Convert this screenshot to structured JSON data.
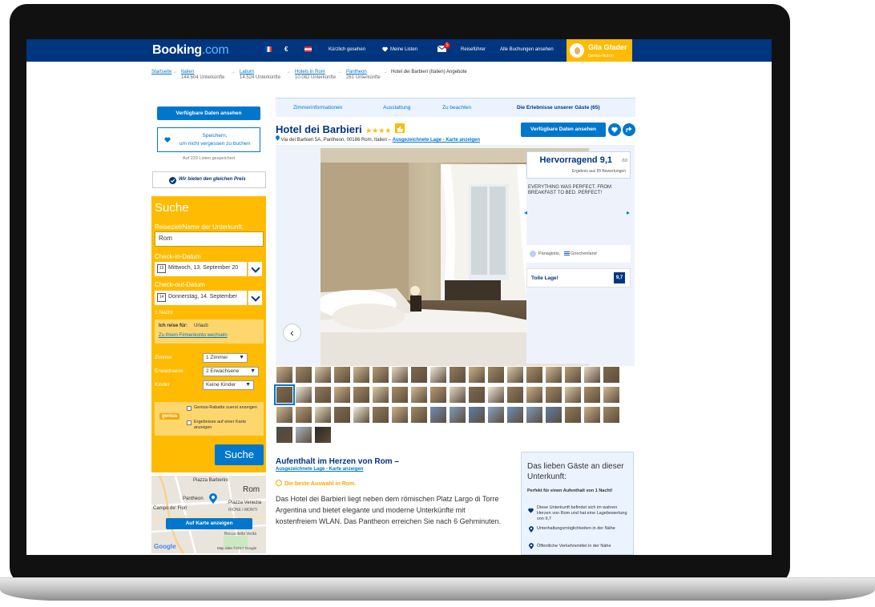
{
  "header": {
    "logo_main": "Booking",
    "logo_dot": ".com",
    "currency": "€",
    "recently_viewed": "Kürzlich gesehen",
    "my_lists": "Meine Listen",
    "mail_badge": "5",
    "travel_guide": "Reiseführer",
    "all_bookings": "Alle Buchungen ansehen",
    "user_name": "Gila Gfader",
    "user_level": "Genius-Nutzer",
    "colors": {
      "brand": "#003580",
      "accent": "#febb02",
      "link": "#0077cc"
    }
  },
  "breadcrumbs": [
    {
      "label": "Startseite",
      "sub": ""
    },
    {
      "label": "Italien",
      "sub": "144.604 Unterkünfte"
    },
    {
      "label": "Latium",
      "sub": "14.524 Unterkünfte"
    },
    {
      "label": "Hotels in Rom",
      "sub": "10.082 Unterkünfte"
    },
    {
      "label": "Pantheon",
      "sub": "261 Unterkünfte"
    },
    {
      "label": "Hotel dei Barbieri (Italien) Angebote",
      "sub": ""
    }
  ],
  "sidebar": {
    "availability_button": "Verfügbare Daten ansehen",
    "save_line1": "Speichern,",
    "save_line2": "um nicht vergessen zu buchen",
    "saved_count": "Auf 229 Listen gespeichert",
    "price_match": "Wir bieten den gleichen Preis",
    "search": {
      "title": "Suche",
      "destination_label": "Reiseziel/Name der Unterkunft:",
      "destination_value": "Rom",
      "checkin_label": "Check-in-Datum",
      "checkin_value": "Mittwoch, 13. September 20",
      "checkin_day": "13",
      "checkout_label": "Check-out-Datum",
      "checkout_value": "Donnerstag, 14. September",
      "checkout_day": "14",
      "nights": "1 Nacht",
      "travel_for": "Ich reise für:",
      "travel_for_value": "Urlaub",
      "business_link": "Zu Ihrem Firmenkonto wechseln",
      "rooms_label": "Zimmer",
      "rooms_value": "1 Zimmer",
      "adults_label": "Erwachsene",
      "adults_value": "2 Erwachsene",
      "children_label": "Kinder",
      "children_value": "Keine Kinder",
      "genius_badge": "genius",
      "genius_option": "Genius-Rabatte zuerst anzeigen",
      "map_option": "Ergebnisse auf einer Karte anzeigen",
      "submit": "Suche"
    },
    "map": {
      "label_top": "Piazza Barberini",
      "label_city": "Rom",
      "label_pantheon": "Pantheon",
      "label_venezia": "Piazza Venezia",
      "label_campo": "Campo de' Fiori",
      "label_rione": "RIONE I MONTI",
      "label_bocca": "Bocca della Verità",
      "button": "Auf Karte anzeigen",
      "provider": "Google",
      "credits": "Map data ©2017 Google"
    }
  },
  "tabs": [
    {
      "label": "Zimmerinformationen",
      "active": false
    },
    {
      "label": "Ausstattung",
      "active": false
    },
    {
      "label": "Zu beachten",
      "active": false
    },
    {
      "label": "Die Erlebnisse unserer Gäste (65)",
      "active": true
    }
  ],
  "hotel": {
    "name": "Hotel dei Barbieri",
    "stars": 4,
    "stars_glyph": "★★★★",
    "address": "Via dei Barbieri 5A, Pantheon, 00186 Rom, Italien –",
    "location_link": "Ausgezeichnete Lage - Karte anzeigen",
    "availability_button": "Verfügbare Daten ansehen"
  },
  "review": {
    "score_label": "Hervorragend",
    "score": "9,1",
    "score_max": "/10",
    "score_basis": "Ergebnis aus 65 Bewertungen",
    "quote": "EVERYTHING WAS PERFECT. FROM BREAKFAST TO BED. PERFECT!",
    "reviewer": "Panagiotis,",
    "reviewer_country": "Griechenland",
    "location_label": "Tolle Lage!",
    "location_score": "9,7"
  },
  "description": {
    "title": "Aufenthalt im Herzen von Rom –",
    "location_link": "Ausgezeichnete Lage - Karte anzeigen",
    "best_choice": "Die beste Auswahl in Rom.",
    "body": "Das Hotel dei Barbieri liegt neben dem römischen Platz Largo di Torre Argentina und bietet elegante und moderne Unterkünfte mit kostenfreiem WLAN. Das Pantheon erreichen Sie nach 6 Gehminuten."
  },
  "guests_love": {
    "title": "Das lieben Gäste an dieser Unterkunft:",
    "perfect_for": "Perfekt für einen Aufenthalt von 1 Nacht!",
    "items": [
      "Diese Unterkunft befindet sich im wahren Herzen von Rom und hat eine Lagebewertung von 9,7",
      "Unterhaltungsmöglichkeiten in der Nähe",
      "Öffentliche Verkehrsmittel in der Nähe"
    ]
  }
}
